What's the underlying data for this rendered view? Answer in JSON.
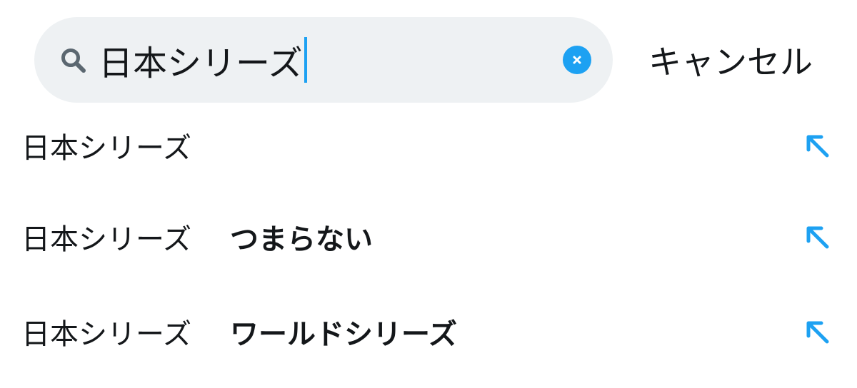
{
  "search": {
    "query": "日本シリーズ"
  },
  "cancel_label": "キャンセル",
  "accent_color": "#1da1f2",
  "icons": {
    "search": "search-icon",
    "clear": "clear-icon",
    "fill_query": "arrow-up-left-icon"
  },
  "suggestions": [
    {
      "query": "日本シリーズ",
      "completion": ""
    },
    {
      "query": "日本シリーズ",
      "completion": "つまらない"
    },
    {
      "query": "日本シリーズ",
      "completion": "ワールドシリーズ"
    }
  ]
}
